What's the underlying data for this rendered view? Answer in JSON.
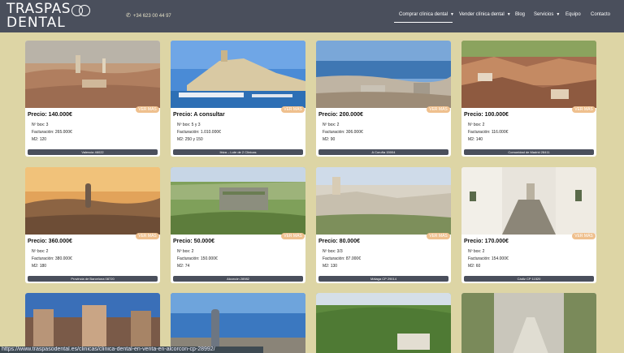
{
  "header": {
    "logo_line1": "TRASPAS",
    "logo_line2": "DENTAL",
    "phone": "+34 623 00 44 97",
    "nav": [
      {
        "label": "Comprar clínica dental",
        "dropdown": true,
        "active": true
      },
      {
        "label": "Vender clínica dental",
        "dropdown": true,
        "active": false
      },
      {
        "label": "Blog",
        "dropdown": false,
        "active": false
      },
      {
        "label": "Servicios",
        "dropdown": true,
        "active": false
      },
      {
        "label": "Equipo",
        "dropdown": false,
        "active": false
      },
      {
        "label": "Contacto",
        "dropdown": false,
        "active": false
      }
    ]
  },
  "cards": [
    {
      "badge": "VER MÁS",
      "price": "Precio: 140.000€",
      "box": "Nº box: 3",
      "facturacion": "Facturación: 265.000€",
      "m2": "M2: 120",
      "location": "Valencia 46022",
      "image": "valencia-city-aerial"
    },
    {
      "badge": "VER MÁS",
      "price": "Precio:  A consultar",
      "box": "Nº box: 5 y 3",
      "facturacion": "Facturación: 1.010.000€",
      "m2": "M2: 250 y 150",
      "location": "Ibiza – Lote de 2 Clínicas",
      "image": "ibiza-harbour"
    },
    {
      "badge": "VER MÁS",
      "price": "Precio: 200.000€",
      "box": "Nº box: 2",
      "facturacion": "Facturación: 306.000€",
      "m2": "M2: 90",
      "location": "A Coruña 15004",
      "image": "coruna-coast"
    },
    {
      "badge": "VER MÁS",
      "price": "Precio: 100.000€",
      "box": "Nº box: 2",
      "facturacion": "Facturación: 116.000€",
      "m2": "M2: 140",
      "location": "Comunidad de Madrid 28411",
      "image": "madrid-rooftops"
    },
    {
      "badge": "VER MÁS",
      "price": "Precio: 360.000€",
      "box": "Nº box: 2",
      "facturacion": "Facturación: 380.000€",
      "m2": "M2: 180",
      "location": "Provincia de Barcelona 08720",
      "image": "barcelona-sunset"
    },
    {
      "badge": "VER MÁS",
      "price": "Precio: 50.000€",
      "box": "Nº box: 2",
      "facturacion": "Facturación: 150.000€",
      "m2": "M2: 74",
      "location": "Alcorcón 28982",
      "image": "alcorcon-building"
    },
    {
      "badge": "VER MÁS",
      "price": "Precio: 80.000€",
      "box": "Nº box: 3/3",
      "facturacion": "Facturación: 87.000€",
      "m2": "M2: 130",
      "location": "Málaga CP 29014",
      "image": "malaga-city"
    },
    {
      "badge": "VER MÁS",
      "price": "Precio: 170.000€",
      "box": "Nº box: 2",
      "facturacion": "Facturación: 154.000€",
      "m2": "M2: 60",
      "location": "Cádiz CP 11520",
      "image": "cadiz-street"
    },
    {
      "image": "madrid-night-buildings"
    },
    {
      "image": "barcelona-tower-sea"
    },
    {
      "image": "green-hills-village"
    },
    {
      "image": "palm-promenade"
    }
  ],
  "status_url": "https://www.traspasodental.es/clinicas/clinica-dental-en-venta-en-alcorcon-cp-28992/"
}
